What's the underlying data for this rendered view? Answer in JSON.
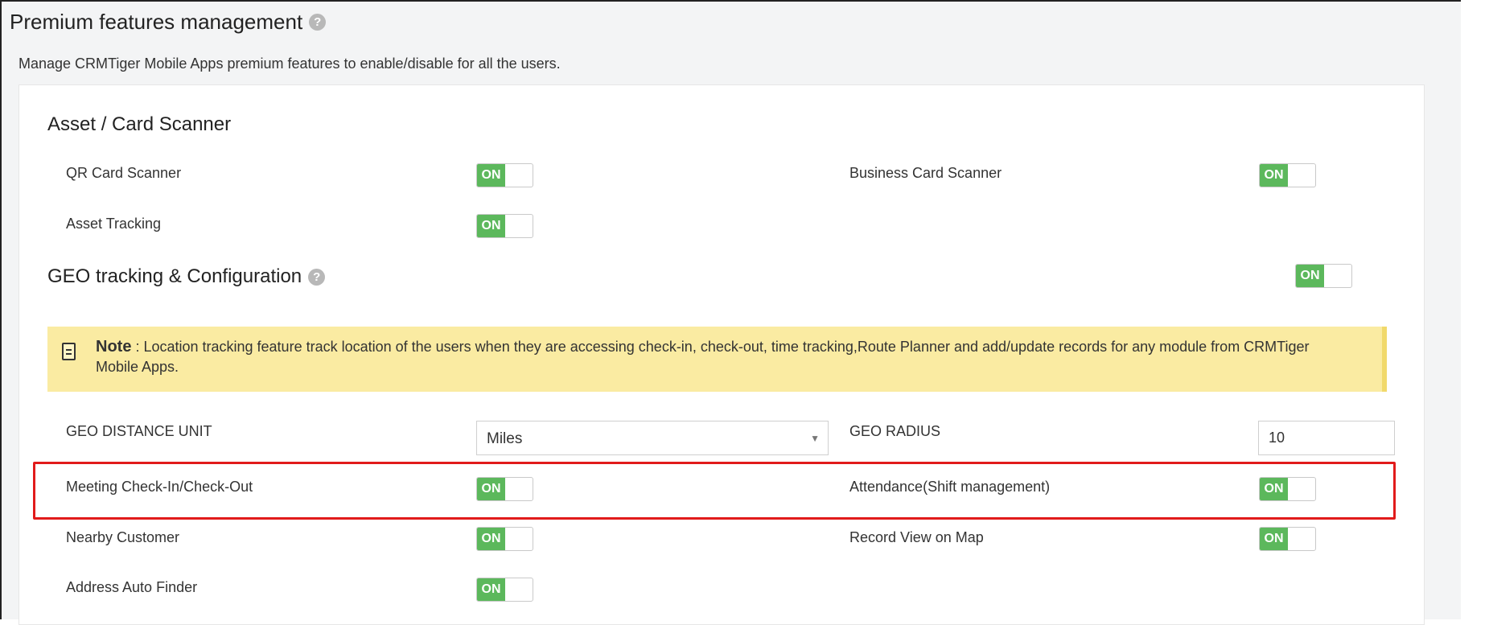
{
  "header": {
    "title": "Premium features management",
    "help_icon": "?",
    "description": "Manage CRMTiger Mobile Apps premium features to enable/disable for all the users."
  },
  "asset_section": {
    "title": "Asset / Card Scanner",
    "qr_card_scanner": {
      "label": "QR Card Scanner",
      "state": "ON"
    },
    "business_card_scanner": {
      "label": "Business Card Scanner",
      "state": "ON"
    },
    "asset_tracking": {
      "label": "Asset Tracking",
      "state": "ON"
    }
  },
  "geo_section": {
    "title": "GEO tracking & Configuration",
    "help_icon": "?",
    "state": "ON",
    "note": {
      "heading": "Note",
      "text": " : Location tracking feature track location of the users when they are accessing check-in, check-out, time tracking,Route Planner and add/update records for any module from CRMTiger Mobile Apps."
    },
    "distance_unit": {
      "label": "GEO DISTANCE UNIT",
      "value": "Miles"
    },
    "radius": {
      "label": "GEO RADIUS",
      "value": "10"
    },
    "meeting_checkin": {
      "label": "Meeting Check-In/Check-Out",
      "state": "ON"
    },
    "attendance": {
      "label": "Attendance(Shift management)",
      "state": "ON"
    },
    "nearby_customer": {
      "label": "Nearby Customer",
      "state": "ON"
    },
    "record_view_on_map": {
      "label": "Record View on Map",
      "state": "ON"
    },
    "address_auto_finder": {
      "label": "Address Auto Finder",
      "state": "ON"
    }
  },
  "colors": {
    "toggle_on": "#5cb85c",
    "note_background": "#faeba2",
    "highlight_border": "#e11b1b"
  }
}
